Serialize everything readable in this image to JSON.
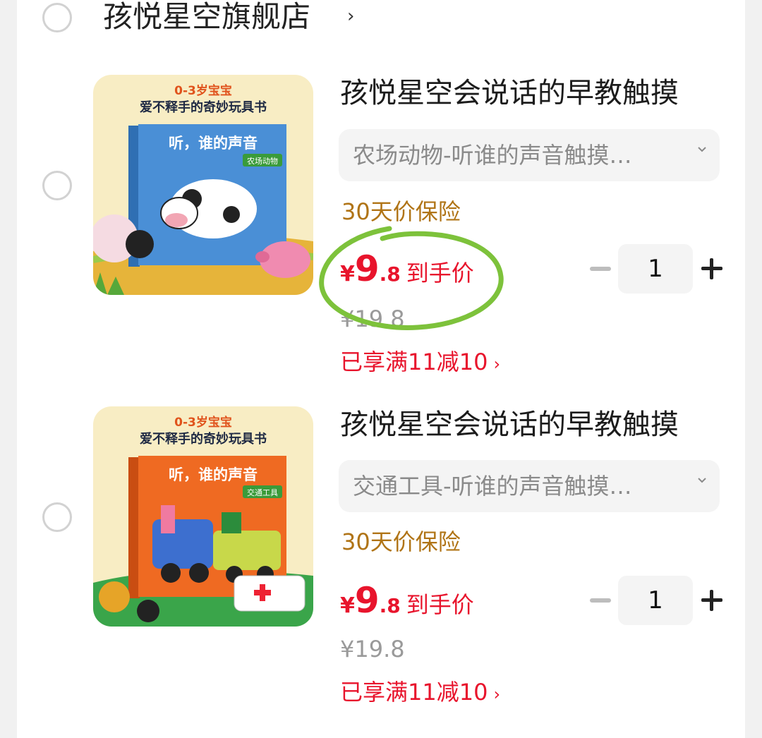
{
  "shop": {
    "name": "孩悦星空旗舰店",
    "chevron": "›"
  },
  "items": [
    {
      "title": "孩悦星空会说话的早教触摸",
      "sku": "农场动物-听谁的声音触摸…",
      "insurance": "30天价保险",
      "price_symbol": "¥",
      "price_int": "9",
      "price_dec": ".8",
      "price_label": "到手价",
      "original_price": "¥19.8",
      "promo": "已享满11减10",
      "quantity": "1",
      "cover": {
        "top_line": "0-3岁宝宝",
        "sub_line": "爱不释手的奇妙玩具书",
        "book_title": "听，谁的声音",
        "book_tag": "农场动物",
        "color": "#4a8fd6"
      }
    },
    {
      "title": "孩悦星空会说话的早教触摸",
      "sku": "交通工具-听谁的声音触摸…",
      "insurance": "30天价保险",
      "price_symbol": "¥",
      "price_int": "9",
      "price_dec": ".8",
      "price_label": "到手价",
      "original_price": "¥19.8",
      "promo": "已享满11减10",
      "quantity": "1",
      "cover": {
        "top_line": "0-3岁宝宝",
        "sub_line": "爱不释手的奇妙玩具书",
        "book_title": "听，谁的声音",
        "book_tag": "交通工具",
        "color": "#ef6a22"
      }
    }
  ],
  "promo_chevron": "›",
  "colors": {
    "price_red": "#e8142c",
    "insurance_gold": "#b07416",
    "circle_green": "#7dc23b"
  }
}
